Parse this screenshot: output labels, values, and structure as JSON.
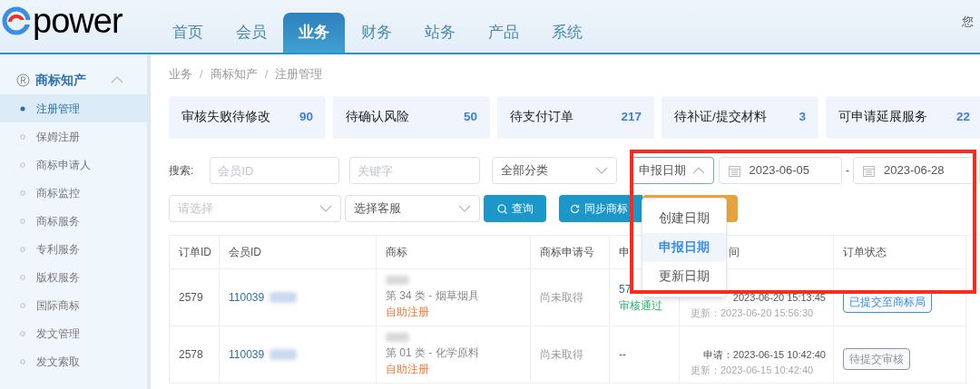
{
  "header": {
    "logo": "power",
    "greeting": "您",
    "nav_tabs": [
      {
        "label": "首页",
        "selected": false
      },
      {
        "label": "会员",
        "selected": false
      },
      {
        "label": "业务",
        "selected": true
      },
      {
        "label": "财务",
        "selected": false
      },
      {
        "label": "站务",
        "selected": false
      },
      {
        "label": "产品",
        "selected": false
      },
      {
        "label": "系统",
        "selected": false
      }
    ]
  },
  "sidebar": {
    "group": {
      "label": "商标知产",
      "expanded": true
    },
    "items": [
      {
        "label": "注册管理",
        "selected": true
      },
      {
        "label": "保姆注册",
        "selected": false
      },
      {
        "label": "商标申请人",
        "selected": false
      },
      {
        "label": "商标监控",
        "selected": false
      },
      {
        "label": "商标服务",
        "selected": false
      },
      {
        "label": "专利服务",
        "selected": false
      },
      {
        "label": "版权服务",
        "selected": false
      },
      {
        "label": "国际商标",
        "selected": false
      },
      {
        "label": "发文管理",
        "selected": false
      },
      {
        "label": "发文索取",
        "selected": false
      }
    ]
  },
  "breadcrumb": [
    {
      "kind": "link",
      "text": "业务"
    },
    {
      "kind": "separator",
      "text": "/"
    },
    {
      "kind": "link",
      "text": "商标知产"
    },
    {
      "kind": "separator",
      "text": "/"
    },
    {
      "kind": "link",
      "text": "注册管理"
    }
  ],
  "stat_cards": [
    {
      "label": "审核失败待修改",
      "count": "90"
    },
    {
      "label": "待确认风险",
      "count": "50"
    },
    {
      "label": "待支付订单",
      "count": "217"
    },
    {
      "label": "待补证/提交材料",
      "count": "3"
    },
    {
      "label": "可申请延展服务",
      "count": "22"
    }
  ],
  "filters": {
    "search_label": "搜索:",
    "member_id": {
      "placeholder": "会员ID"
    },
    "keyword": {
      "placeholder": "关键字"
    },
    "category": {
      "value": "全部分类"
    },
    "date_type": {
      "value": "申报日期",
      "expanded": true,
      "options": [
        {
          "label": "创建日期",
          "selected": false
        },
        {
          "label": "申报日期",
          "selected": true
        },
        {
          "label": "更新日期",
          "selected": false
        }
      ]
    },
    "date_from": "2023-06-05",
    "date_separator": "-",
    "date_to": "2023-06-28",
    "select_1": {
      "placeholder": "请选择"
    },
    "service_select": {
      "value": "选择客服"
    },
    "buttons": [
      {
        "kind": "query",
        "label": "查询"
      },
      {
        "kind": "sync",
        "label": "同步商标"
      },
      {
        "kind": "extra"
      }
    ]
  },
  "table": {
    "columns": [
      "订单ID",
      "会员ID",
      "商标",
      "商标申请号",
      "申",
      "间",
      "订单状态"
    ],
    "rows": [
      {
        "order_id": "2579",
        "member_id": "110039",
        "category": "第 34 类 - 烟草烟具",
        "source": "自助注册",
        "application_no": "尚未取得",
        "review_no": "57",
        "review_status": "审核通过",
        "times": [
          "2023-06-20 15:13:45",
          "更新：2023-06-20 15:56:30"
        ],
        "status": "已提交至商标局",
        "color": "#3a8ee6"
      },
      {
        "order_id": "2578",
        "member_id": "110039",
        "category": "第 01 类 - 化学原料",
        "source": "自助注册",
        "application_no": "尚未取得",
        "review_no": "--",
        "times": [
          "申请：2023-06-15 10:42:40",
          "更新：2023-06-15 10:42:40"
        ],
        "status": "待提交审核",
        "color": "#909399"
      }
    ]
  }
}
